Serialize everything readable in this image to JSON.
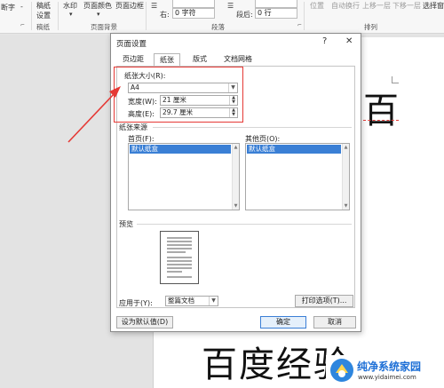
{
  "ribbon": {
    "break_label": "断字",
    "break_arrow": "-",
    "manuscript_label_1": "稿纸",
    "manuscript_label_2": "设置",
    "watermark_label": "水印",
    "page_color_label": "页面颜色",
    "page_border_label": "页面边框",
    "indent_right_label": "右:",
    "indent_right_value": "0 字符",
    "spacing_after_label": "段后:",
    "spacing_after_value": "0 行",
    "position_label": "位置",
    "wrap_label": "自动换行",
    "forward_label": "上移一层",
    "backward_label": "下移一层",
    "select_label": "选择窗",
    "group_manuscript": "稿纸",
    "group_page_bg": "页面背景",
    "group_paragraph": "段落",
    "group_arrange": "排列"
  },
  "document": {
    "char_top": "百",
    "bottom_text": "百度经验"
  },
  "dialog": {
    "title": "页面设置",
    "help_label": "?",
    "close_label": "✕",
    "tabs": [
      {
        "label": "页边距"
      },
      {
        "label": "纸张"
      },
      {
        "label": "版式"
      },
      {
        "label": "文档网格"
      }
    ],
    "paper_size_label": "纸张大小(R):",
    "paper_size_value": "A4",
    "width_label": "宽度(W):",
    "width_value": "21 厘米",
    "height_label": "高度(E):",
    "height_value": "29.7 厘米",
    "paper_source_label": "纸张来源",
    "first_page_label": "首页(F):",
    "first_page_selected": "默认纸盒",
    "other_pages_label": "其他页(O):",
    "other_pages_selected": "默认纸盒",
    "preview_label": "预览",
    "apply_to_label": "应用于(Y):",
    "apply_to_value": "整篇文档",
    "print_options_label": "打印选项(T)...",
    "set_default_label": "设为默认值(D)",
    "ok_label": "确定",
    "cancel_label": "取消"
  },
  "watermark": {
    "name": "纯净系统家园",
    "url": "www.yidaimei.com"
  },
  "colors": {
    "annotation": "#e53935",
    "accent": "#3a7fd5",
    "watermark_brand": "#1d6fd6"
  }
}
